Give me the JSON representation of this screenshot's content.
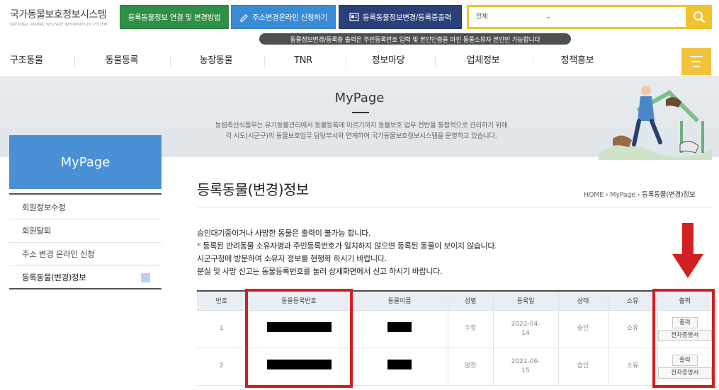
{
  "header": {
    "logo_title": "국가동물보호정보시스템",
    "logo_subtitle": "NATIONAL ANIMAL WELFARE INFORMATION SYSTEM",
    "buttons": [
      {
        "label": "등록동물정보 연결 및 변경방법",
        "color": "#2f8f46"
      },
      {
        "label": "주소변경온라인 신청하기",
        "color": "#3a8bd6"
      },
      {
        "label": "등록동물정보변경/등록증출력",
        "color": "#2b3f78"
      }
    ],
    "search": {
      "category": "전체",
      "value": "",
      "accent": "#f0c22c"
    },
    "tooltip": "동물정보변경/등록증 출력은 주민등록번호 입력 및 본인인증을 마친 동물소유자 본인만 가능합니다"
  },
  "nav": {
    "items": [
      "구조동물",
      "동물등록",
      "농장동물",
      "TNR",
      "정보마당",
      "업체정보",
      "정책홍보"
    ],
    "menu_icon": "hamburger-icon"
  },
  "banner": {
    "title": "MyPage",
    "desc_line1": "농림축산식품부는 유기동물관리에서 동물등록에 이르기까지 동물보호 업무 전반을 통합적으로 관리하기 위해",
    "desc_line2": "각 시도(시군구)의 동물보호업무 담당부서와 연계하여 국가동물보호정보시스템을 운영하고 있습니다."
  },
  "sidebar": {
    "title": "MyPage",
    "items": [
      {
        "label": "회원정보수정"
      },
      {
        "label": "회원탈퇴"
      },
      {
        "label": "주소 변경 온라인 신청"
      },
      {
        "label": "등록동물(변경)정보"
      }
    ]
  },
  "main": {
    "title": "등록동물(변경)정보",
    "breadcrumb": [
      "HOME",
      "MyPage",
      "등록동물(변경)정보"
    ],
    "notices": [
      "승인대기중이거나 사망한 동물은 출력이 불가능 합니다.",
      "등록된 반려동물 소유자명과 주민등록번호가 일치하지 않으면 등록된 동물이 보이지 않습니다.",
      "시군구청에 방문하여 소유자 정보를 현행화 하시기 바랍니다.",
      "분실 및 사망 신고는 동물등록번호를 눌러 상세화면에서 신고 하시기 바랍니다."
    ],
    "notice_star": "*"
  },
  "table": {
    "headers": [
      "번호",
      "동물등록번호",
      "동물이름",
      "성별",
      "등록일",
      "상태",
      "소유",
      "출력"
    ],
    "rows": [
      {
        "no": "1",
        "sex": "수컷",
        "date_a": "2022-04-",
        "date_b": "14",
        "status": "승인",
        "owner": "소유",
        "print": "출력",
        "cert": "전자증명서"
      },
      {
        "no": "2",
        "sex": "암컷",
        "date_a": "2021-06-",
        "date_b": "15",
        "status": "승인",
        "owner": "소유",
        "print": "출력",
        "cert": "전자증명서"
      }
    ]
  },
  "annotation_color": "#d21f1f"
}
